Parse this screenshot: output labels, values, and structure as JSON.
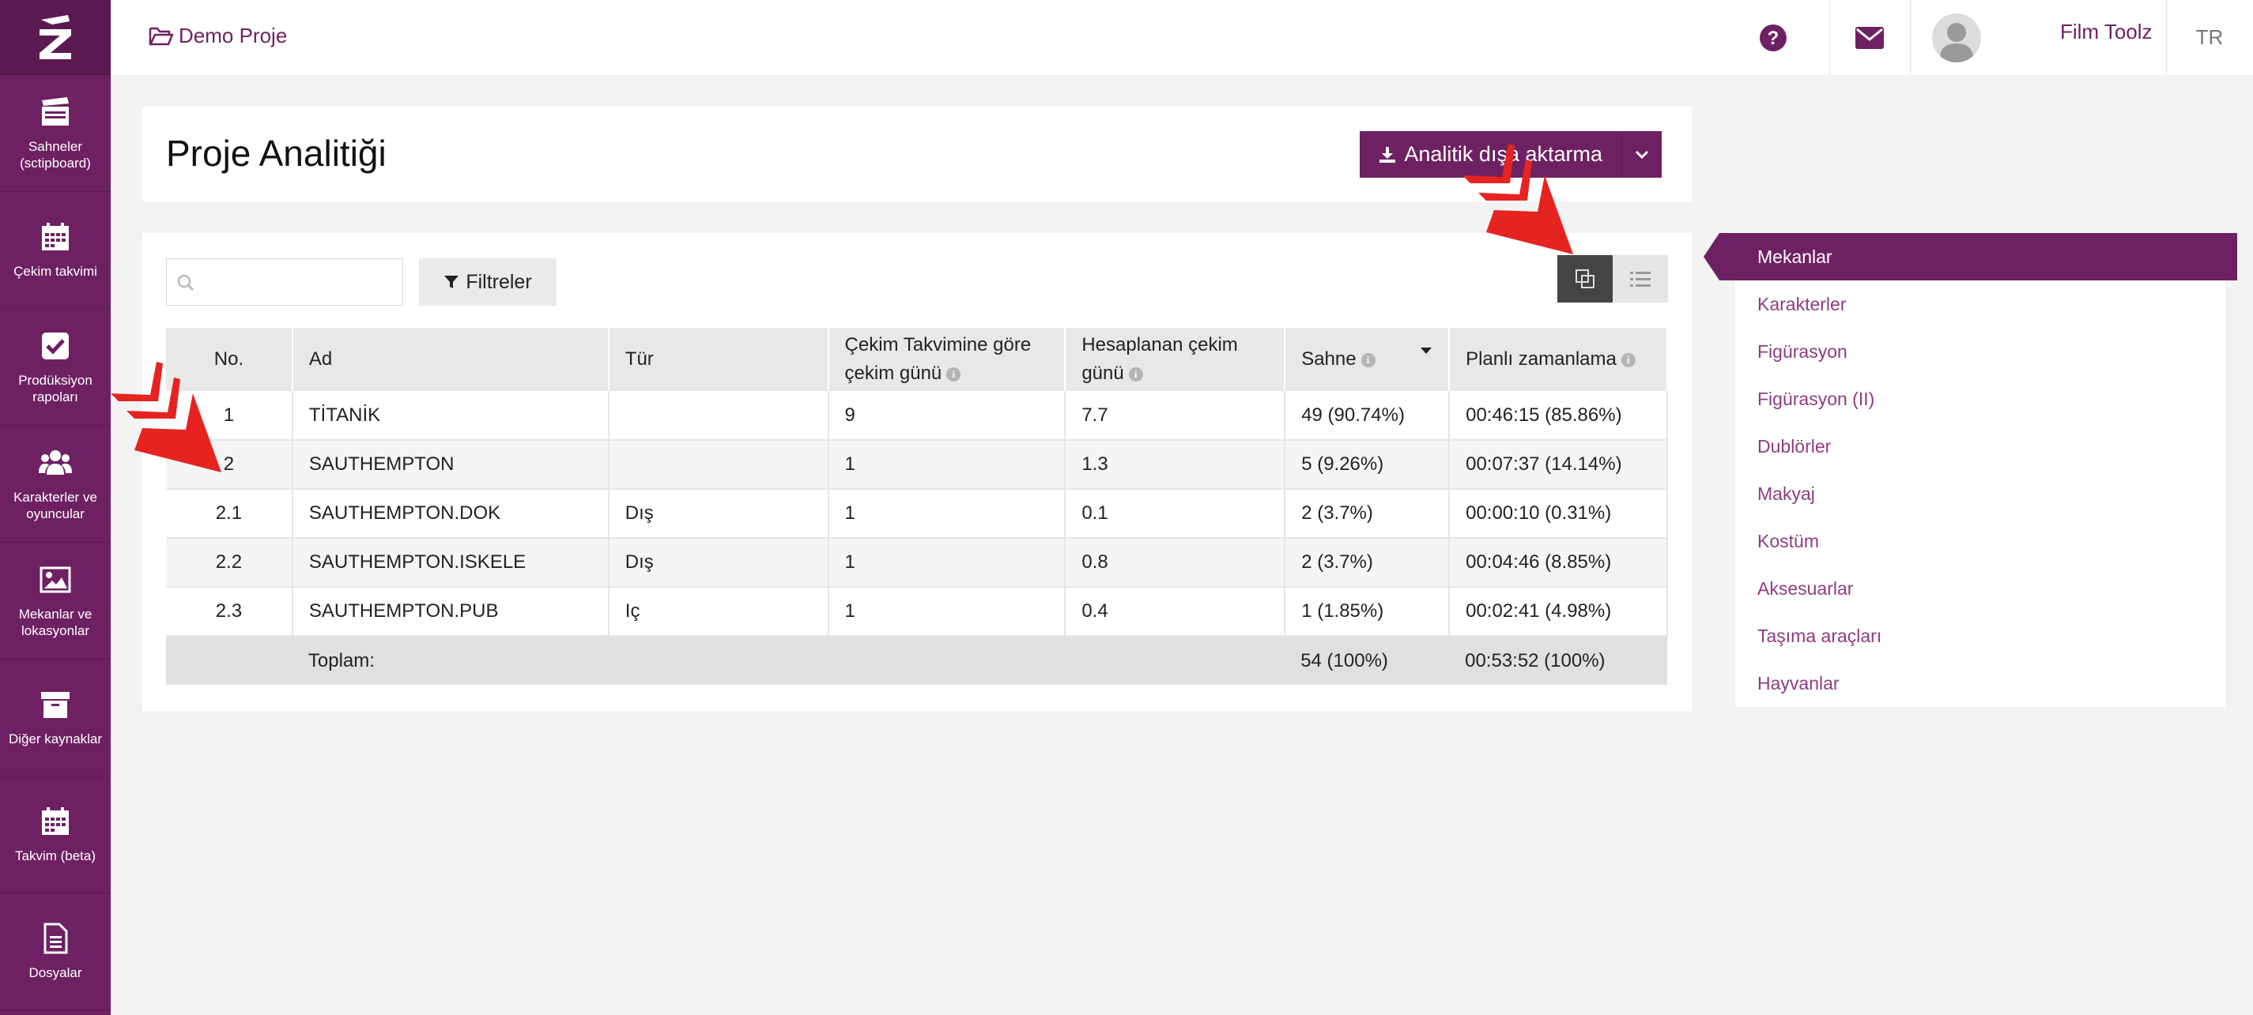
{
  "sidebar": {
    "logo": "Z",
    "items": [
      {
        "label": "Sahneler (sctipboard)",
        "icon": "clapperboard-icon"
      },
      {
        "label": "Çekim takvimi",
        "icon": "calendar-icon"
      },
      {
        "label": "Prodüksiyon rapoları",
        "icon": "checkbox-icon"
      },
      {
        "label": "Karakterler ve oyuncular",
        "icon": "users-icon"
      },
      {
        "label": "Mekanlar ve lokasyonlar",
        "icon": "image-icon"
      },
      {
        "label": "Diğer kaynaklar",
        "icon": "archive-icon"
      },
      {
        "label": "Takvim (beta)",
        "icon": "calendar-icon"
      },
      {
        "label": "Dosyalar",
        "icon": "file-icon"
      }
    ]
  },
  "topbar": {
    "project": "Demo Proje",
    "user": "Film Toolz",
    "lang": "TR"
  },
  "header": {
    "title": "Proje Analitiği",
    "export_label": "Analitik dışa aktarma"
  },
  "toolbar": {
    "search_placeholder": "",
    "filter_label": "Filtreler"
  },
  "table": {
    "columns": [
      "No.",
      "Ad",
      "Tür",
      "Çekim Takvimine göre çekim günü",
      "Hesaplanan çekim günü",
      "Sahne",
      "Planlı zamanlama"
    ],
    "rows": [
      [
        "1",
        "TİTANİK",
        "",
        "9",
        "7.7",
        "49 (90.74%)",
        "00:46:15 (85.86%)"
      ],
      [
        "2",
        "SAUTHEMPTON",
        "",
        "1",
        "1.3",
        "5 (9.26%)",
        "00:07:37 (14.14%)"
      ],
      [
        "2.1",
        "SAUTHEMPTON.DOK",
        "Dış",
        "1",
        "0.1",
        "2 (3.7%)",
        "00:00:10 (0.31%)"
      ],
      [
        "2.2",
        "SAUTHEMPTON.ISKELE",
        "Dış",
        "1",
        "0.8",
        "2 (3.7%)",
        "00:04:46 (8.85%)"
      ],
      [
        "2.3",
        "SAUTHEMPTON.PUB",
        "Iç",
        "1",
        "0.4",
        "1 (1.85%)",
        "00:02:41 (4.98%)"
      ]
    ],
    "footer": {
      "label": "Toplam:",
      "scenes": "54 (100%)",
      "time": "00:53:52 (100%)"
    }
  },
  "right_panel": {
    "active": "Mekanlar",
    "items": [
      "Karakterler",
      "Figürasyon",
      "Figürasyon (II)",
      "Dublörler",
      "Makyaj",
      "Kostüm",
      "Aksesuarlar",
      "Taşıma araçları",
      "Hayvanlar"
    ]
  },
  "colors": {
    "brand": "#6e2162",
    "link": "#8e3c80",
    "annotation_arrow": "#e52421"
  }
}
